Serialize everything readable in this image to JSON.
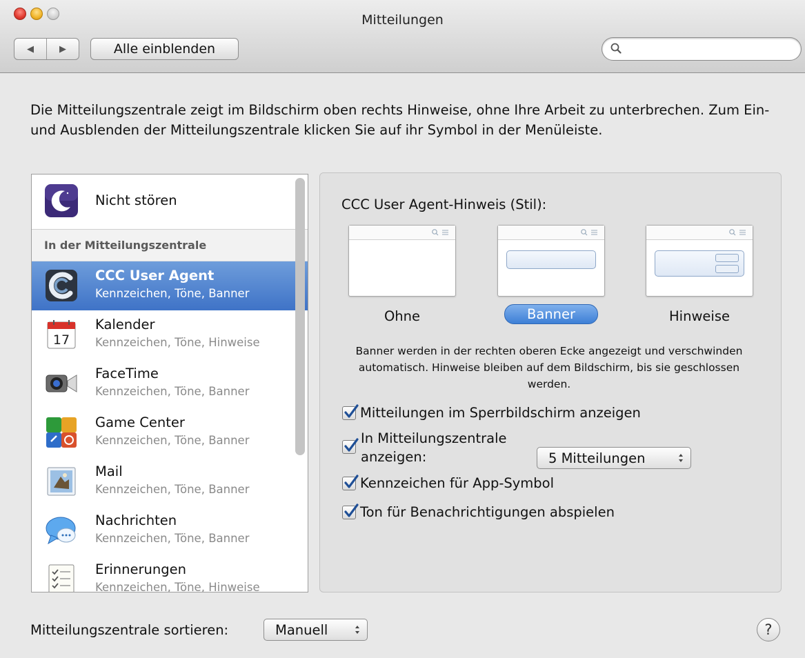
{
  "window": {
    "title": "Mitteilungen"
  },
  "toolbar": {
    "back_label": "◀",
    "forward_label": "▶",
    "show_all_label": "Alle einblenden",
    "search_placeholder": ""
  },
  "intro_text": "Die Mitteilungszentrale zeigt im Bildschirm oben rechts Hinweise, ohne Ihre Arbeit zu unterbrechen. Zum Ein- und Ausblenden der Mitteilungszentrale klicken Sie auf ihr Symbol in der Menüleiste.",
  "sidebar": {
    "dnd_label": "Nicht stören",
    "section_header": "In der Mitteilungszentrale",
    "apps": [
      {
        "name": "CCC User Agent",
        "sub": "Kennzeichen, Töne, Banner",
        "icon": "ccc-icon",
        "selected": true
      },
      {
        "name": "Kalender",
        "sub": "Kennzeichen, Töne, Hinweise",
        "icon": "calendar-icon",
        "day": "17"
      },
      {
        "name": "FaceTime",
        "sub": "Kennzeichen, Töne, Banner",
        "icon": "facetime-icon"
      },
      {
        "name": "Game Center",
        "sub": "Kennzeichen, Töne, Banner",
        "icon": "game-center-icon"
      },
      {
        "name": "Mail",
        "sub": "Kennzeichen, Töne, Banner",
        "icon": "mail-icon"
      },
      {
        "name": "Nachrichten",
        "sub": "Kennzeichen, Töne, Banner",
        "icon": "messages-icon"
      },
      {
        "name": "Erinnerungen",
        "sub": "Kennzeichen, Töne, Hinweise",
        "icon": "reminders-icon"
      }
    ]
  },
  "detail": {
    "style_title": "CCC User Agent-Hinweis (Stil):",
    "styles": [
      {
        "label": "Ohne",
        "selected": false
      },
      {
        "label": "Banner",
        "selected": true
      },
      {
        "label": "Hinweise",
        "selected": false
      }
    ],
    "description": "Banner werden in der rechten oberen Ecke angezeigt und verschwinden automatisch. Hinweise bleiben auf dem Bildschirm, bis sie geschlossen werden.",
    "checkboxes": {
      "lock_screen": {
        "label": "Mitteilungen im Sperrbildschirm anzeigen",
        "checked": true
      },
      "notification_center_line1": "In Mitteilungszentrale",
      "notification_center_line2": "anzeigen:",
      "notification_center_checked": true,
      "badge": {
        "label": "Kennzeichen für App-Symbol",
        "checked": true
      },
      "sound": {
        "label": "Ton für Benachrichtigungen abspielen",
        "checked": true
      }
    },
    "count_popup": "5 Mitteilungen"
  },
  "footer": {
    "sort_label": "Mitteilungszentrale sortieren:",
    "sort_value": "Manuell",
    "help_label": "?"
  },
  "colors": {
    "selection": "#3f73c7",
    "checkmark": "#1f4f96"
  }
}
